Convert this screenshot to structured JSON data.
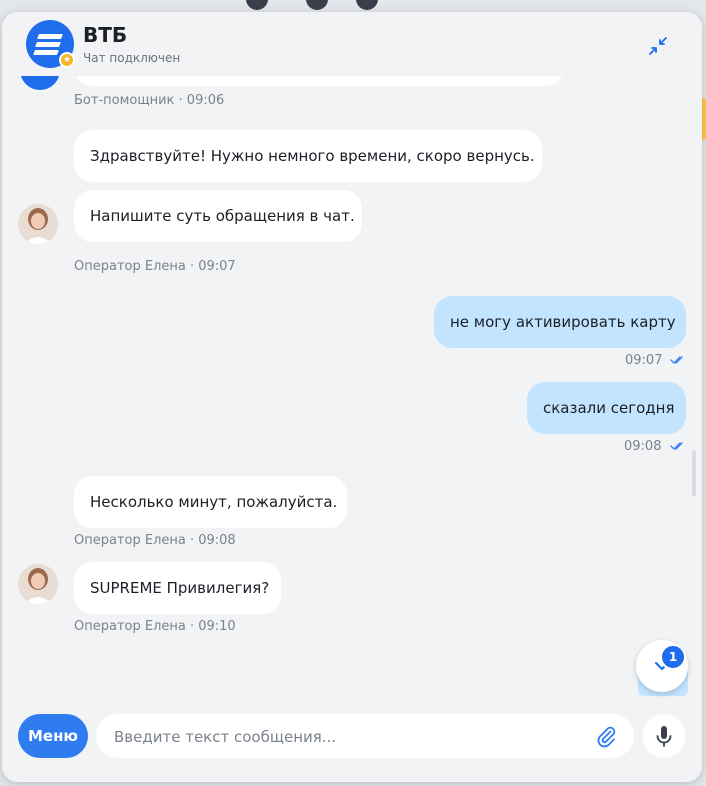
{
  "colors": {
    "brand": "#1f6cec",
    "incoming_bubble": "#ffffff",
    "outgoing_bubble": "#c2e4ff",
    "meta_text": "#7b828c"
  },
  "header": {
    "title": "ВТБ",
    "subtitle": "Чат подключен",
    "logo_icon": "vtb-logo-icon",
    "collapse_icon": "collapse-icon"
  },
  "messages": {
    "bot_meta": "Бот-помощник · 09:06",
    "op1_text": "Здравствуйте! Нужно немного времени, скоро вернусь.",
    "op2_text": "Напишите суть обращения в чат.",
    "op2_meta": "Оператор Елена · 09:07",
    "user1_text": "не могу активировать карту",
    "user1_time": "09:07",
    "user2_text": "сказали сегодня",
    "user2_time": "09:08",
    "op3_text": "Несколько минут, пожалуйста.",
    "op3_meta": "Оператор Елена · 09:08",
    "op4_text": "SUPREME Привилегия?",
    "op4_meta": "Оператор Елена · 09:10"
  },
  "scroll_down": {
    "badge_count": "1",
    "icon": "chevron-down-icon"
  },
  "input": {
    "menu_label": "Меню",
    "placeholder": "Введите текст сообщения...",
    "attach_icon": "paperclip-icon",
    "mic_icon": "microphone-icon"
  }
}
